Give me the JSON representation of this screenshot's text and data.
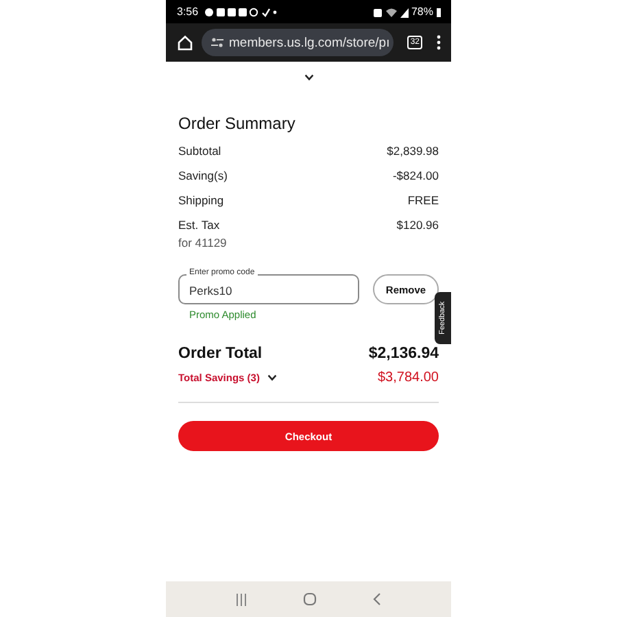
{
  "status_bar": {
    "time": "3:56",
    "battery": "78%"
  },
  "browser": {
    "url": "members.us.lg.com/store/pı",
    "tab_count": "32"
  },
  "order_summary": {
    "title": "Order Summary",
    "lines": [
      {
        "label": "Subtotal",
        "value": "$2,839.98"
      },
      {
        "label": "Saving(s)",
        "value": "-$824.00"
      },
      {
        "label": "Shipping",
        "value": "FREE"
      },
      {
        "label": "Est. Tax",
        "value": "$120.96",
        "note": "for 41129"
      }
    ],
    "promo": {
      "label": "Enter promo code",
      "value": "Perks10",
      "status": "Promo Applied",
      "button": "Remove"
    },
    "total": {
      "label": "Order Total",
      "value": "$2,136.94"
    },
    "savings": {
      "label": "Total Savings (3)",
      "value": "$3,784.00",
      "expanded": false
    },
    "checkout": "Checkout"
  },
  "feedback": "Feedback"
}
